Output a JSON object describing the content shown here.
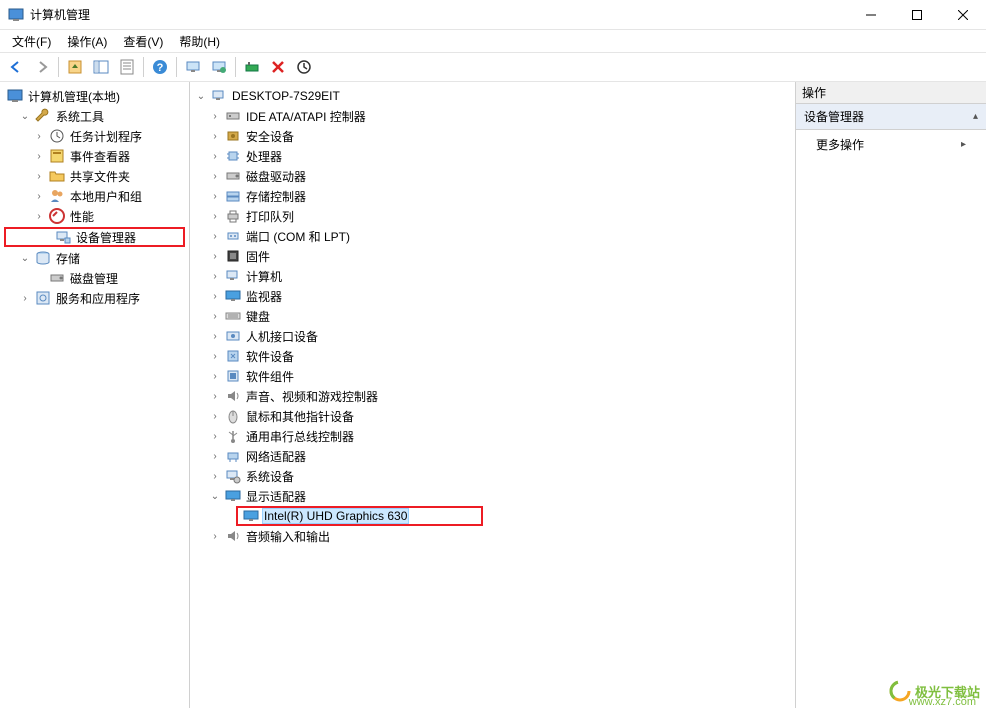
{
  "titlebar": {
    "title": "计算机管理"
  },
  "menubar": [
    "文件(F)",
    "操作(A)",
    "查看(V)",
    "帮助(H)"
  ],
  "left_tree": {
    "root": {
      "label": "计算机管理(本地)",
      "icon": "computer-mgmt-icon"
    },
    "system_tools": {
      "label": "系统工具",
      "icon": "wrench-icon"
    },
    "task_scheduler": {
      "label": "任务计划程序",
      "icon": "clock-icon"
    },
    "event_viewer": {
      "label": "事件查看器",
      "icon": "event-icon"
    },
    "shared_folders": {
      "label": "共享文件夹",
      "icon": "folder-share-icon"
    },
    "local_users": {
      "label": "本地用户和组",
      "icon": "users-icon"
    },
    "performance": {
      "label": "性能",
      "icon": "perf-icon"
    },
    "device_manager": {
      "label": "设备管理器",
      "icon": "device-mgr-icon"
    },
    "storage": {
      "label": "存储",
      "icon": "storage-icon"
    },
    "disk_mgmt": {
      "label": "磁盘管理",
      "icon": "disk-icon"
    },
    "services_apps": {
      "label": "服务和应用程序",
      "icon": "services-icon"
    }
  },
  "center_tree": {
    "root": "DESKTOP-7S29EIT",
    "items": [
      {
        "label": "IDE ATA/ATAPI 控制器",
        "icon": "ide-icon"
      },
      {
        "label": "安全设备",
        "icon": "security-icon"
      },
      {
        "label": "处理器",
        "icon": "cpu-icon"
      },
      {
        "label": "磁盘驱动器",
        "icon": "disk-drive-icon"
      },
      {
        "label": "存储控制器",
        "icon": "storage-ctrl-icon"
      },
      {
        "label": "打印队列",
        "icon": "printer-icon"
      },
      {
        "label": "端口 (COM 和 LPT)",
        "icon": "port-icon"
      },
      {
        "label": "固件",
        "icon": "firmware-icon"
      },
      {
        "label": "计算机",
        "icon": "computer-icon"
      },
      {
        "label": "监视器",
        "icon": "monitor-icon"
      },
      {
        "label": "键盘",
        "icon": "keyboard-icon"
      },
      {
        "label": "人机接口设备",
        "icon": "hid-icon"
      },
      {
        "label": "软件设备",
        "icon": "software-icon"
      },
      {
        "label": "软件组件",
        "icon": "component-icon"
      },
      {
        "label": "声音、视频和游戏控制器",
        "icon": "sound-icon"
      },
      {
        "label": "鼠标和其他指针设备",
        "icon": "mouse-icon"
      },
      {
        "label": "通用串行总线控制器",
        "icon": "usb-icon"
      },
      {
        "label": "网络适配器",
        "icon": "network-icon"
      },
      {
        "label": "系统设备",
        "icon": "system-icon"
      }
    ],
    "display_adapters": {
      "label": "显示适配器",
      "icon": "display-icon"
    },
    "gpu": {
      "label": "Intel(R) UHD Graphics 630",
      "icon": "display-device-icon"
    },
    "audio_io": {
      "label": "音频输入和输出",
      "icon": "audio-icon"
    }
  },
  "actions_pane": {
    "header": "操作",
    "section": "设备管理器",
    "more": "更多操作"
  },
  "watermark": {
    "brand": "极光下载站",
    "url": "www.xz7.com"
  }
}
